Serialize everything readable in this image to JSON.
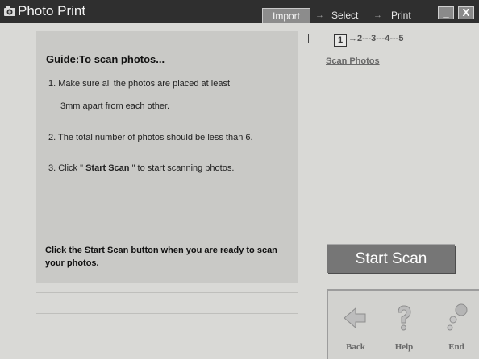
{
  "window": {
    "title": "Photo Print",
    "icon": "camera-icon",
    "minimize_label": "_",
    "close_label": "X"
  },
  "wizard": {
    "tabs": [
      {
        "label": "Import",
        "active": true
      },
      {
        "label": "Select",
        "active": false
      },
      {
        "label": "Print",
        "active": false
      }
    ],
    "arrow": "→",
    "step_current": "1",
    "step_rest": "→2---3---4---5",
    "sub_link": "Scan Photos"
  },
  "guide": {
    "title": "Guide:To scan photos...",
    "step1_line1": "1. Make sure all the photos are placed at least",
    "step1_line2": "3mm apart from each other.",
    "step2": "2. The total number of photos should be less than 6.",
    "step3_prefix": "3. Click \" ",
    "step3_bold": "Start Scan",
    "step3_suffix": " \" to start scanning photos.",
    "note": "Click the Start Scan button when you are ready to scan your photos."
  },
  "actions": {
    "start_scan": "Start Scan"
  },
  "nav": {
    "back": {
      "label": "Back",
      "icon": "back-arrow-icon"
    },
    "help": {
      "label": "Help",
      "icon": "question-mark-icon"
    },
    "end": {
      "label": "End",
      "icon": "end-spheres-icon"
    }
  },
  "colors": {
    "titlebar": "#2f2f2f",
    "background": "#d9d9d6",
    "panel": "#c9c9c6",
    "button": "#767676"
  }
}
